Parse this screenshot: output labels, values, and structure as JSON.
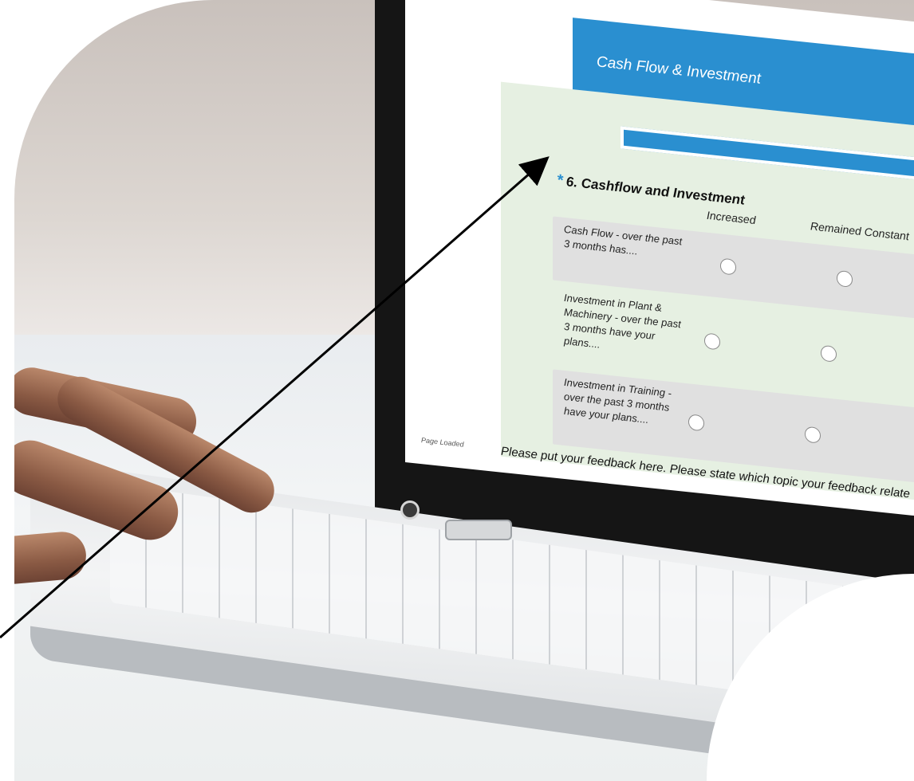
{
  "survey": {
    "page_title": "Cash Flow & Investment",
    "question_star": "*",
    "question_title": "6. Cashflow and Investment",
    "columns": [
      "Increased",
      "Remained Constant"
    ],
    "rows": [
      "Cash Flow - over the past 3 months has....",
      "Investment in Plant & Machinery - over the past 3 months have your plans....",
      "Investment in Training - over the past 3 months have your plans...."
    ],
    "feedback_prompt": "Please put your feedback here. Please state which topic your feedback relate",
    "status_text": "Page Loaded"
  },
  "colors": {
    "header_blue": "#2a8fd0",
    "form_background": "#e6f0e2",
    "row_background": "#e0e0e0"
  },
  "icons": [
    "arrow-pointer-icon",
    "webcam-icon"
  ]
}
